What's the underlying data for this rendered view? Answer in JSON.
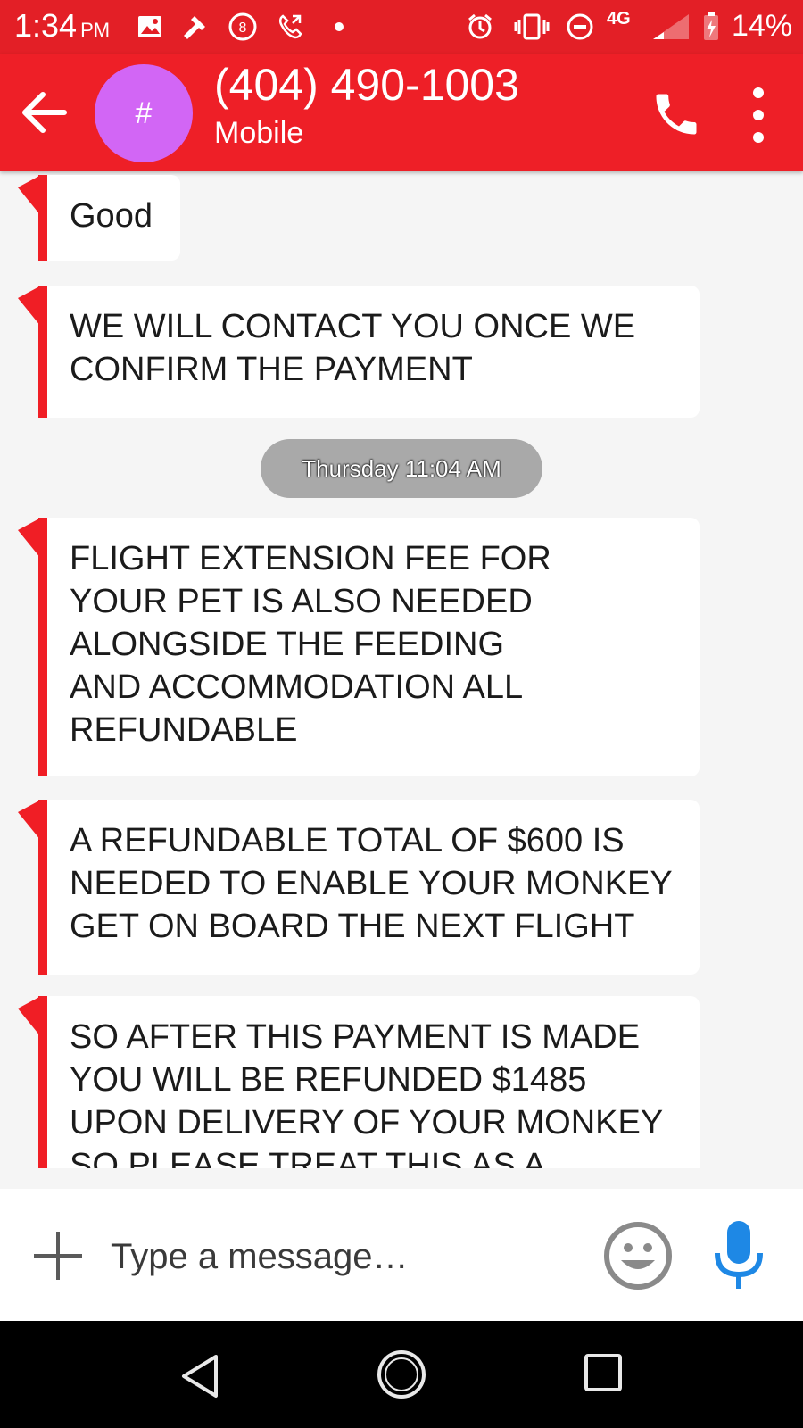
{
  "status_bar": {
    "time": "1:34",
    "ampm": "PM",
    "network": "4G",
    "battery": "14%"
  },
  "header": {
    "avatar_text": "#",
    "title": "(404) 490-1003",
    "subtitle": "Mobile"
  },
  "messages": [
    {
      "text": "Good"
    },
    {
      "text": "WE WILL CONTACT YOU ONCE WE\nCONFIRM THE PAYMENT"
    },
    {
      "text": "FLIGHT EXTENSION FEE FOR\nYOUR PET IS ALSO NEEDED\nALONGSIDE THE FEEDING\nAND ACCOMMODATION ALL\nREFUNDABLE"
    },
    {
      "text": "A REFUNDABLE TOTAL OF $600 IS\nNEEDED TO ENABLE YOUR MONKEY\nGET ON BOARD THE NEXT FLIGHT"
    },
    {
      "text": "SO AFTER THIS PAYMENT IS MADE\nYOU WILL BE REFUNDED $1485\nUPON DELIVERY OF YOUR MONKEY\nSO PLEASE TREAT THIS AS A"
    }
  ],
  "timestamp": "Thursday 11:04 AM",
  "compose": {
    "placeholder": "Type a message…"
  },
  "colors": {
    "accent": "#ee1f27",
    "avatar": "#d266f5",
    "mic": "#1e88e5"
  },
  "icons": [
    "back-arrow-icon",
    "phone-icon",
    "more-vert-icon",
    "plus-icon",
    "emoji-icon",
    "mic-icon",
    "chevron-down-double-icon"
  ]
}
